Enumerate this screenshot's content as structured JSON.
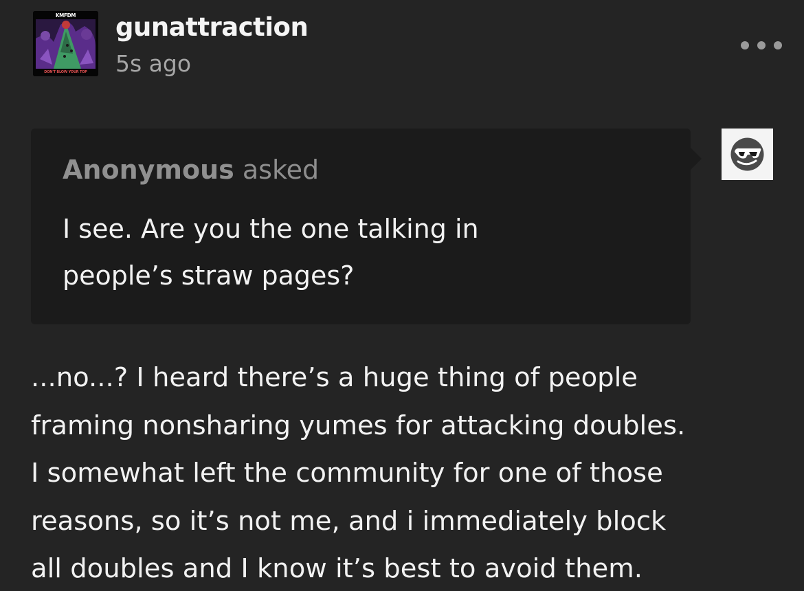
{
  "post": {
    "blog_name": "gunattraction",
    "timestamp": "5s ago",
    "avatar": {
      "top_text": "KMFDM",
      "bottom_text": "DON'T BLOW YOUR TOP"
    },
    "more_icon": "ellipsis-icon"
  },
  "ask": {
    "asker": "Anonymous",
    "verb": "asked",
    "question_lines": [
      "I see. Are you the one talking in",
      "people’s straw pages?"
    ],
    "asker_avatar_icon": "sunglasses-face-icon"
  },
  "answer": {
    "lines": [
      "...no...? I heard there’s a huge thing of people",
      "framing nonsharing yumes for attacking doubles.",
      "I somewhat left the community for one of those",
      "reasons, so it’s not me, and i immediately block",
      "all doubles and I know it’s best to avoid them."
    ]
  },
  "colors": {
    "background": "#242424",
    "bubble": "#1b1b1b",
    "text": "#f2f2f2",
    "muted": "#a6a6a6"
  }
}
